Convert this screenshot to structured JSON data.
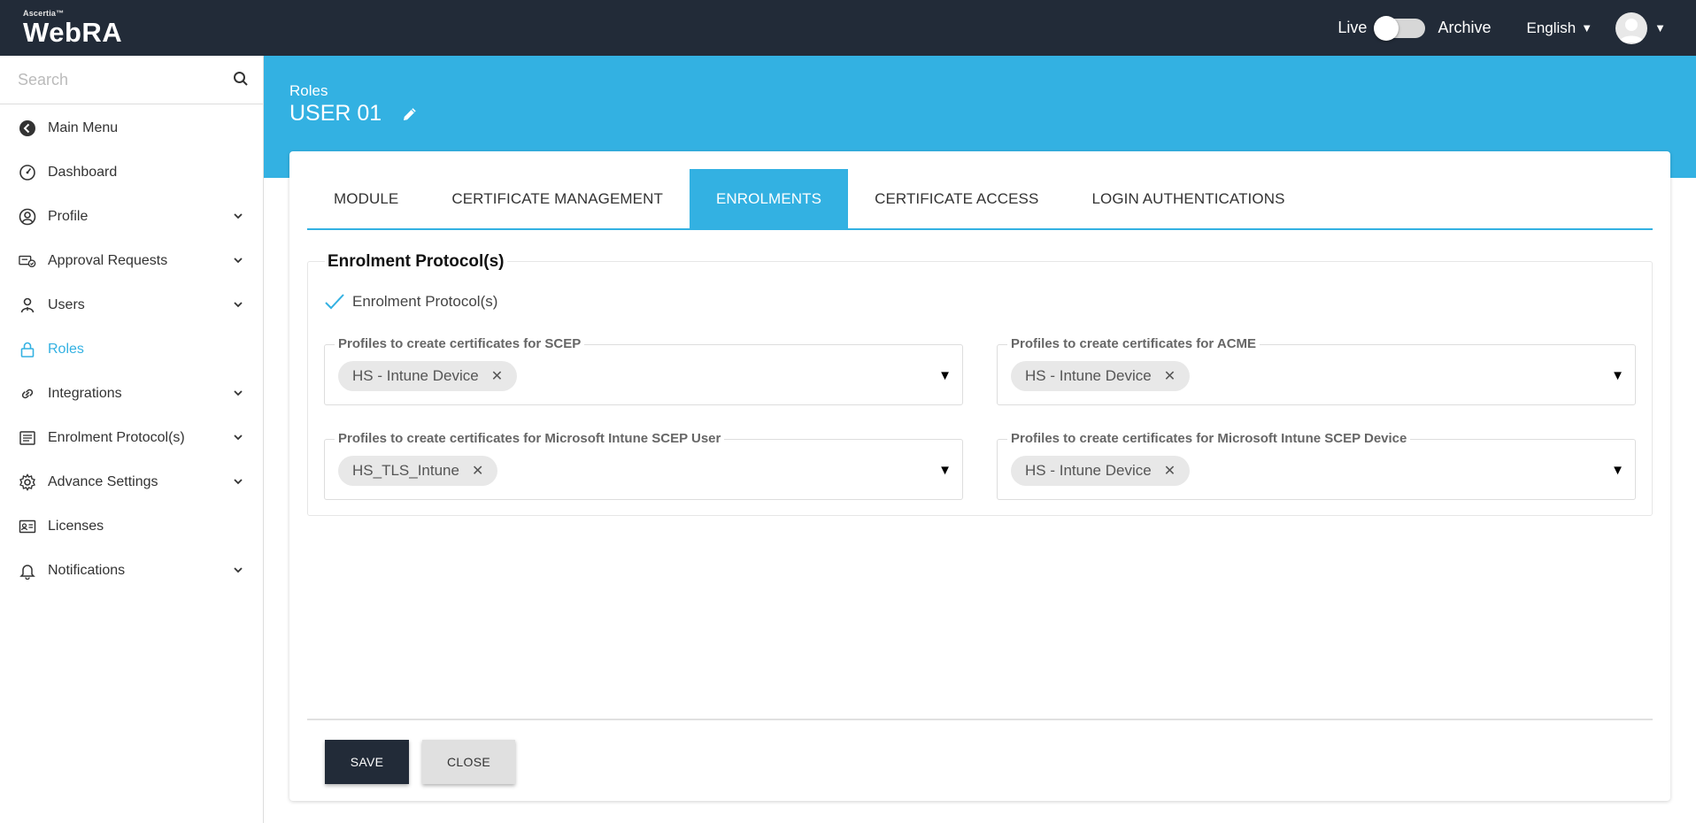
{
  "app": {
    "vendor": "Ascertia™",
    "name": "WebRA"
  },
  "topbar": {
    "live_label": "Live",
    "archive_label": "Archive",
    "language": "English"
  },
  "sidebar": {
    "search_placeholder": "Search",
    "items": [
      {
        "label": "Main Menu",
        "icon": "back-circle-icon"
      },
      {
        "label": "Dashboard",
        "icon": "dashboard-gauge-icon"
      },
      {
        "label": "Profile",
        "icon": "user-circle-icon",
        "expandable": true
      },
      {
        "label": "Approval Requests",
        "icon": "approval-icon",
        "expandable": true
      },
      {
        "label": "Users",
        "icon": "users-icon",
        "expandable": true
      },
      {
        "label": "Roles",
        "icon": "lock-icon",
        "active": true
      },
      {
        "label": "Integrations",
        "icon": "link-icon",
        "expandable": true
      },
      {
        "label": "Enrolment Protocol(s)",
        "icon": "enrolment-icon",
        "expandable": true
      },
      {
        "label": "Advance Settings",
        "icon": "gear-icon",
        "expandable": true
      },
      {
        "label": "Licenses",
        "icon": "license-card-icon"
      },
      {
        "label": "Notifications",
        "icon": "bell-icon",
        "expandable": true
      }
    ]
  },
  "header": {
    "breadcrumb": "Roles",
    "title": "USER 01"
  },
  "tabs": [
    {
      "label": "MODULE"
    },
    {
      "label": "CERTIFICATE MANAGEMENT"
    },
    {
      "label": "ENROLMENTS",
      "active": true
    },
    {
      "label": "CERTIFICATE ACCESS"
    },
    {
      "label": "LOGIN AUTHENTICATIONS"
    }
  ],
  "enrolments": {
    "section_title": "Enrolment Protocol(s)",
    "checkbox_label": "Enrolment Protocol(s)",
    "checkbox_checked": true,
    "fields": [
      {
        "label": "Profiles to create certificates for SCEP",
        "chip": "HS - Intune Device"
      },
      {
        "label": "Profiles to create certificates for ACME",
        "chip": "HS - Intune Device"
      },
      {
        "label": "Profiles to create certificates for Microsoft Intune SCEP User",
        "chip": "HS_TLS_Intune"
      },
      {
        "label": "Profiles to create certificates for Microsoft Intune SCEP Device",
        "chip": "HS - Intune Device"
      }
    ]
  },
  "actions": {
    "save_label": "SAVE",
    "close_label": "CLOSE"
  },
  "colors": {
    "topbar": "#222b38",
    "accent": "#33b1e2",
    "chip": "#e8e8e8"
  }
}
